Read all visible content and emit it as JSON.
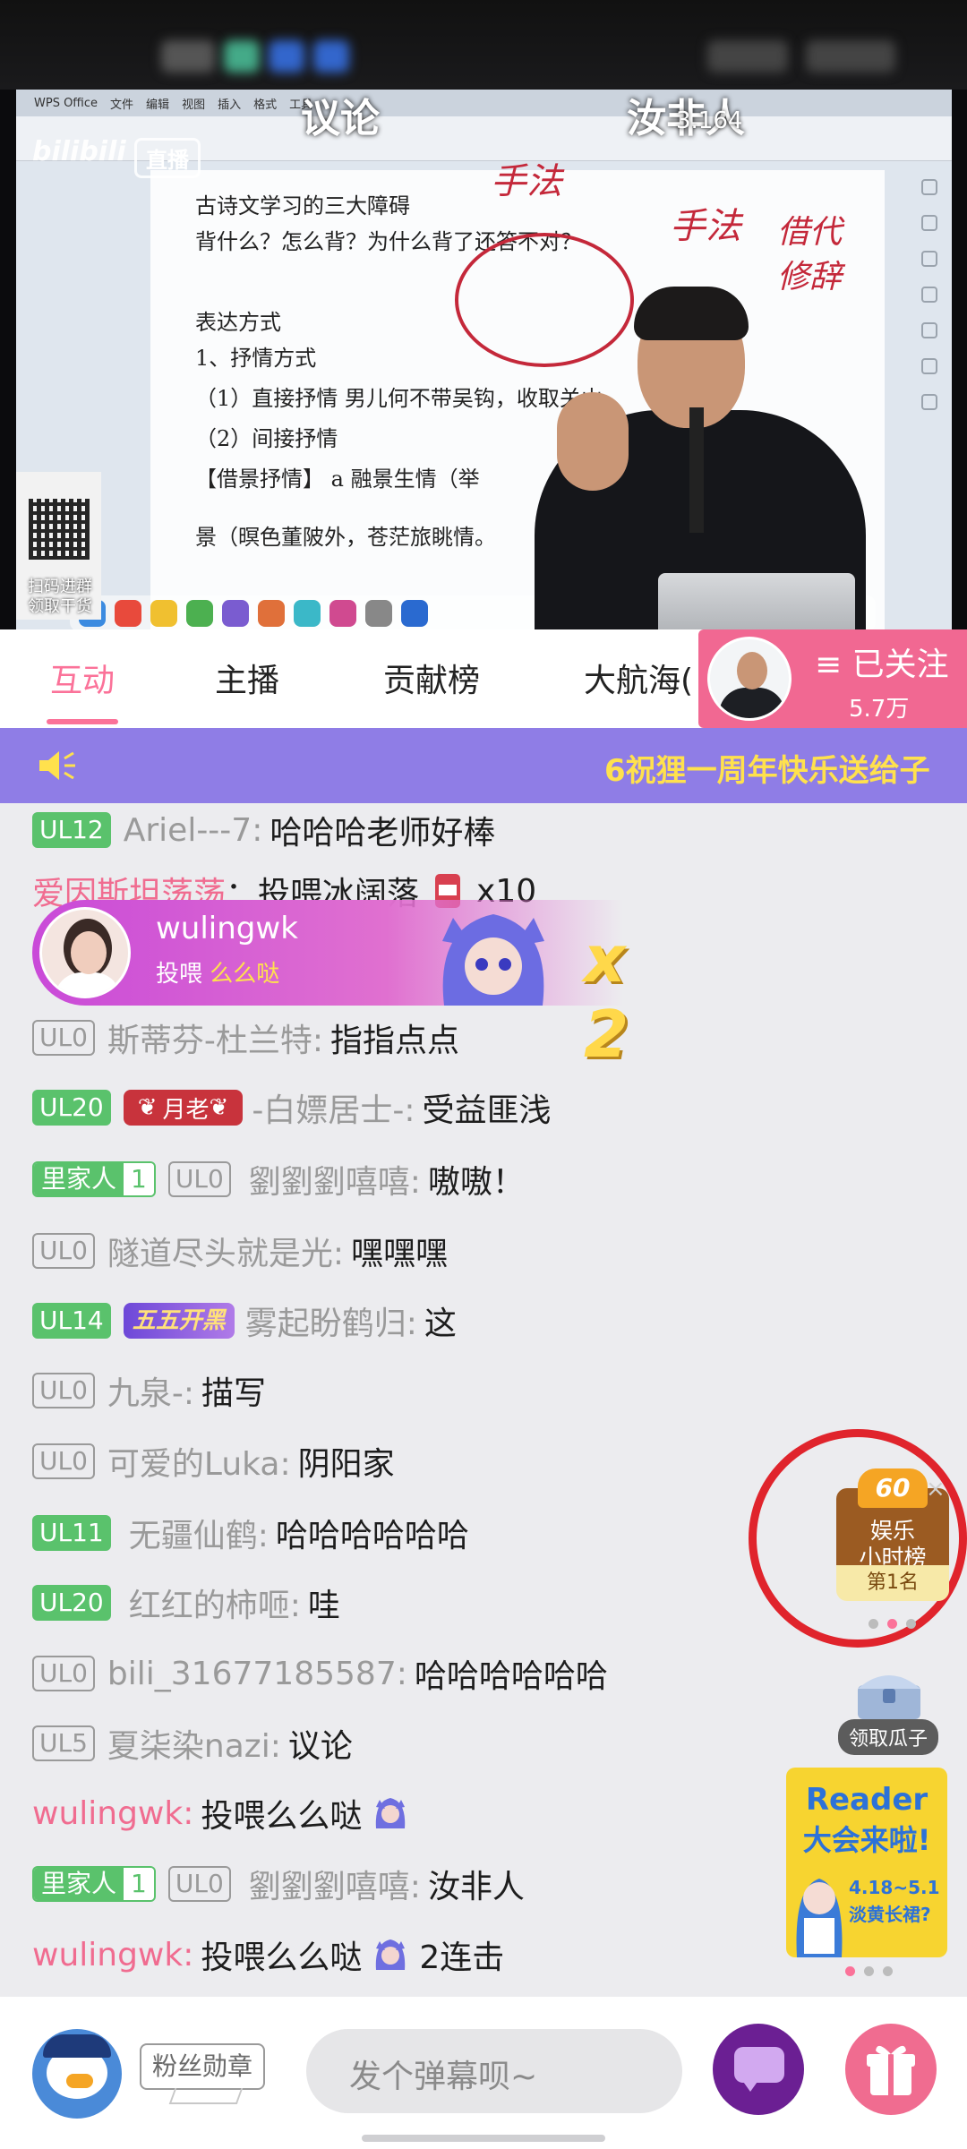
{
  "video": {
    "title_left": "议论",
    "title_right": "汝非人",
    "room_number": "3.164",
    "platform_logo": "bilibili",
    "live_badge": "直播",
    "qr_caption_1": "扫码进群",
    "qr_caption_2": "领取干货",
    "doc_lines": [
      "古诗文学习的三大障碍",
      "背什么？怎么背？为什么背了还答不对？",
      "表达方式",
      "1、抒情方式",
      "（1）直接抒情  男儿何不带吴钩，收取关山",
      "（2）间接抒情",
      "【借景抒情】 a 融景生情（举",
      "景（暝色董陂外，苍茫旅眺情。"
    ],
    "ink_notes": [
      "手法",
      "手法",
      "借代",
      "修辞"
    ]
  },
  "tabs": {
    "items": [
      "互动",
      "主播",
      "贡献榜",
      "大航海("
    ],
    "active_index": 0,
    "accent_color": "#fb7299"
  },
  "follow": {
    "label": "≡ 已关注",
    "count": "5.7万"
  },
  "announcement": {
    "text": "6祝狸一周年快乐送给子",
    "icon": "speaker-icon",
    "text_color": "#ffe14d",
    "bg_color": "#8f7de6"
  },
  "gift_banner": {
    "user": "wulingwk",
    "action": "投喂",
    "gift": "么么哒",
    "multiplier": "x 2"
  },
  "chat": [
    {
      "level": "UL12",
      "level_style": "green",
      "user": "Ariel---7:",
      "text": "哈哈哈老师好棒"
    },
    {
      "user": "爱因斯坦荡荡",
      "user_style": "pink",
      "text": "：投喂冰阔落",
      "gift_icon": "cola-icon",
      "count": "x10"
    },
    {
      "level": "UL0",
      "level_style": "grey",
      "user": "斯蒂芬-杜兰特:",
      "text": "指指点点"
    },
    {
      "level": "UL20",
      "level_style": "green",
      "medal": "月老",
      "user": "-白嫖居士-:",
      "text": "受益匪浅"
    },
    {
      "jiaren": "里家人",
      "jiaren_level": "1",
      "level": "UL0",
      "level_style": "grey",
      "user": "劉劉劉嘻嘻:",
      "text": "嗷嗷！"
    },
    {
      "level": "UL0",
      "level_style": "grey",
      "user": "隧道尽头就是光:",
      "text": "嘿嘿嘿"
    },
    {
      "level": "UL14",
      "level_style": "green",
      "medal2": "五五开黑",
      "user": "雾起盼鹤归:",
      "text": "这"
    },
    {
      "level": "UL0",
      "level_style": "grey",
      "user": "九泉-:",
      "text": "描写"
    },
    {
      "level": "UL0",
      "level_style": "grey",
      "user": "可爱的Luka:",
      "text": "阴阳家"
    },
    {
      "level": "UL11",
      "level_style": "green",
      "user": "无疆仙鹤:",
      "text": "哈哈哈哈哈哈"
    },
    {
      "level": "UL20",
      "level_style": "green",
      "user": "红红的柿咂:",
      "text": "哇"
    },
    {
      "level": "UL0",
      "level_style": "grey",
      "user": "bili_31677185587:",
      "text": "哈哈哈哈哈哈"
    },
    {
      "level": "UL5",
      "level_style": "grey",
      "user": "夏柒染nazi:",
      "text": "议论"
    },
    {
      "user": "wulingwk:",
      "user_style": "pink",
      "text": "投喂么么哒",
      "gift_icon": "mascot-icon"
    },
    {
      "jiaren": "里家人",
      "jiaren_level": "1",
      "level": "UL0",
      "level_style": "grey",
      "user": "劉劉劉嘻嘻:",
      "text": "汝非人"
    },
    {
      "user": "wulingwk:",
      "user_style": "pink",
      "text": "投喂么么哒",
      "gift_icon": "mascot-icon",
      "combo": "2连击"
    }
  ],
  "rank_badge": {
    "num": "60",
    "line1": "娱乐",
    "line2": "小时榜",
    "rank": "第1名",
    "close": "×"
  },
  "chest": {
    "label": "领取瓜子"
  },
  "reader_banner": {
    "title1": "Reader",
    "title2": "大会来啦!",
    "date": "4.18~5.1",
    "sub": "淡黄长裙?"
  },
  "bottom": {
    "fans_label": "粉丝勋章",
    "input_placeholder": "发个弹幕呗~"
  }
}
